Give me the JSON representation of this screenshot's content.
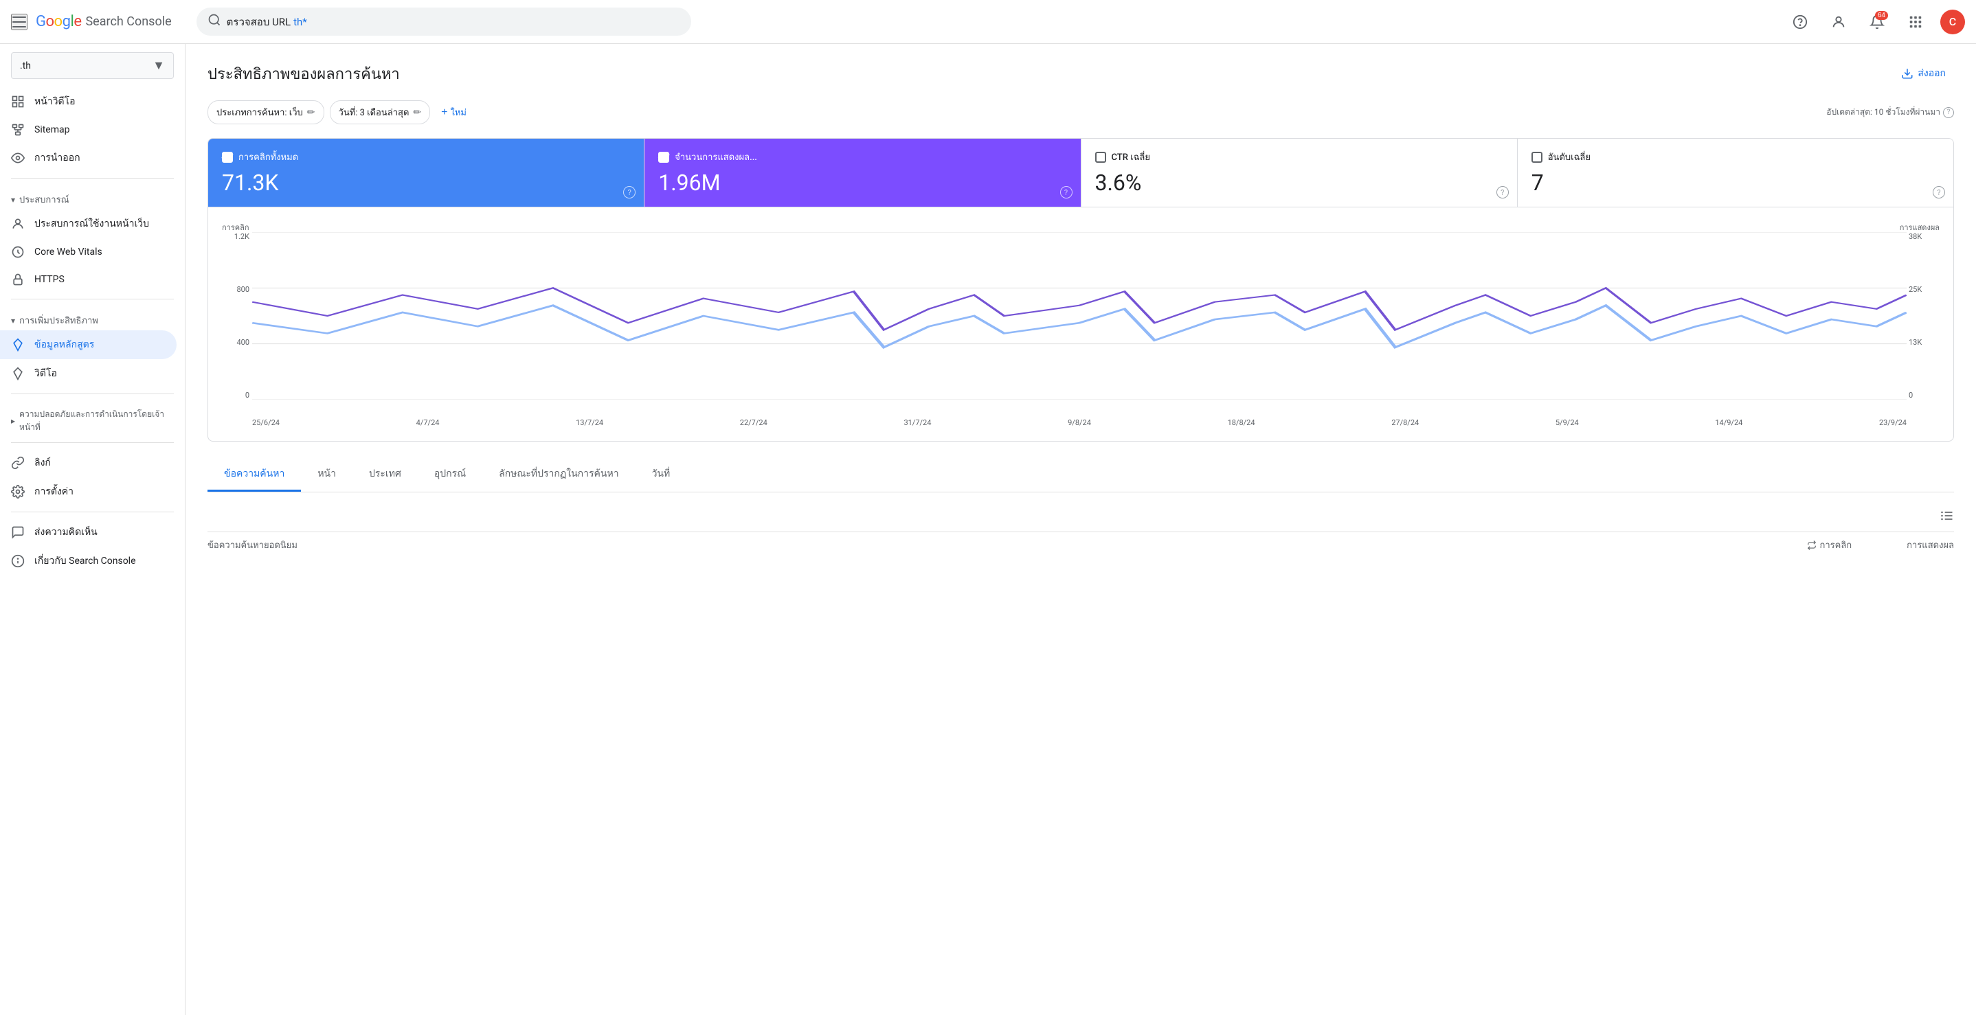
{
  "topbar": {
    "search_placeholder": "ตรวจสอบ URL",
    "search_value": "th*",
    "notification_count": "64",
    "avatar_letter": "C"
  },
  "logo": {
    "google": "Google",
    "product": "Search Console"
  },
  "site_selector": {
    "value": ".th",
    "chevron": "▼"
  },
  "sidebar": {
    "sections": [
      {
        "id": "overview",
        "items": [
          {
            "id": "overview-item",
            "label": "หน้าวิดีโอ",
            "icon": "grid"
          },
          {
            "id": "sitemap",
            "label": "Sitemap",
            "icon": "sitemap"
          },
          {
            "id": "navigation",
            "label": "การนำออก",
            "icon": "eye"
          }
        ]
      }
    ],
    "section_prasopkan": {
      "label": "ประสบการณ์",
      "items": [
        {
          "id": "web-exp",
          "label": "ประสบการณ์ใช้งานหน้าเว็บ",
          "icon": "person"
        },
        {
          "id": "core-web",
          "label": "Core Web Vitals",
          "icon": "circle"
        },
        {
          "id": "https",
          "label": "HTTPS",
          "icon": "lock"
        }
      ]
    },
    "section_enhance": {
      "label": "การเพิ่มประสิทธิภาพ",
      "items": [
        {
          "id": "structured",
          "label": "ข้อมูลหลักสูตร",
          "icon": "diamond",
          "active": true
        },
        {
          "id": "video",
          "label": "วิดีโอ",
          "icon": "diamond"
        }
      ]
    },
    "section_security": {
      "label": "ความปลอดภัยและการดำเนินการโดยเจ้าหน้าที่"
    },
    "section_links": {
      "items": [
        {
          "id": "links",
          "label": "ลิงก์",
          "icon": "link"
        }
      ]
    },
    "section_settings": {
      "items": [
        {
          "id": "settings",
          "label": "การตั้งค่า",
          "icon": "gear"
        }
      ]
    },
    "section_feedback": {
      "items": [
        {
          "id": "feedback",
          "label": "ส่งความคิดเห็น",
          "icon": "chat"
        },
        {
          "id": "about",
          "label": "เกี่ยวกับ Search Console",
          "icon": "info"
        }
      ]
    }
  },
  "main": {
    "page_title": "ประสิทธิภาพของผลการค้นหา",
    "export_label": "ส่งออก",
    "filters": {
      "type_label": "ประเภทการค้นหา: เว็บ",
      "date_label": "วันที่: 3 เดือนล่าสุด",
      "add_label": "ใหม่"
    },
    "last_updated": "อัปเดตล่าสุด: 10 ชั่วโมงที่ผ่านมา",
    "metrics": [
      {
        "id": "clicks",
        "label": "การคลิกทั้งหมด",
        "value": "71.3K",
        "active": "blue",
        "checked": true
      },
      {
        "id": "impressions",
        "label": "จำนวนการแสดงผ...",
        "value": "1.96M",
        "active": "purple",
        "checked": true
      },
      {
        "id": "ctr",
        "label": "CTR เฉลี่ย",
        "value": "3.6%",
        "active": "none",
        "checked": false
      },
      {
        "id": "position",
        "label": "อันดับเฉลี่ย",
        "value": "7",
        "active": "none",
        "checked": false
      }
    ],
    "chart": {
      "y_left_labels": [
        "1.2K",
        "800",
        "400",
        "0"
      ],
      "y_right_labels": [
        "38K",
        "25K",
        "13K",
        "0"
      ],
      "left_axis_label": "การคลิก",
      "right_axis_label": "การแสดงผล",
      "x_labels": [
        "25/6/24",
        "4/7/24",
        "13/7/24",
        "22/7/24",
        "31/7/24",
        "9/8/24",
        "18/8/24",
        "27/8/24",
        "5/9/24",
        "14/9/24",
        "23/9/24"
      ]
    },
    "tabs": [
      {
        "id": "query",
        "label": "ข้อความค้นหา",
        "active": true
      },
      {
        "id": "page",
        "label": "หน้า",
        "active": false
      },
      {
        "id": "country",
        "label": "ประเทศ",
        "active": false
      },
      {
        "id": "device",
        "label": "อุปกรณ์",
        "active": false
      },
      {
        "id": "appearance",
        "label": "ลักษณะที่ปรากฏในการค้นหา",
        "active": false
      },
      {
        "id": "date",
        "label": "วันที่",
        "active": false
      }
    ],
    "table": {
      "title": "ข้อความค้นหายอดนิยม",
      "col_clicks": "การคลิก",
      "col_impressions": "การแสดงผล"
    }
  }
}
